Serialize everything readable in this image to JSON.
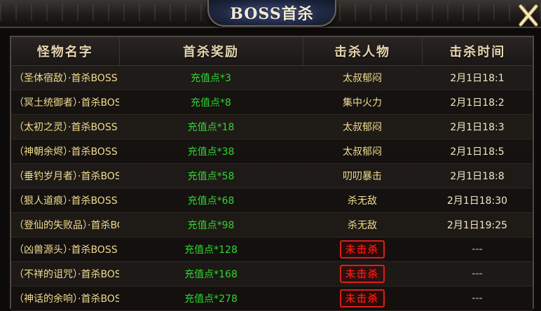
{
  "header": {
    "title": "BOSS首杀"
  },
  "columns": [
    "怪物名字",
    "首杀奖励",
    "击杀人物",
    "击杀时间"
  ],
  "rows": [
    {
      "name": "（圣体宿敌）·首杀BOSS",
      "reward": "充值点*3",
      "killer": "太叔郁闷",
      "time": "2月1日18:1",
      "killed": true
    },
    {
      "name": "（冥土统御者）·首杀BOSS",
      "reward": "充值点*8",
      "killer": "集中火力",
      "time": "2月1日18:2",
      "killed": true
    },
    {
      "name": "（太初之灵）·首杀BOSS",
      "reward": "充值点*18",
      "killer": "太叔郁闷",
      "time": "2月1日18:3",
      "killed": true
    },
    {
      "name": "（神朝余烬）·首杀BOSS",
      "reward": "充值点*38",
      "killer": "太叔郁闷",
      "time": "2月1日18:5",
      "killed": true
    },
    {
      "name": "（垂钓岁月者）·首杀BOSS",
      "reward": "充值点*58",
      "killer": "叨叨暴击",
      "time": "2月1日18:8",
      "killed": true
    },
    {
      "name": "（狠人道痕）·首杀BOSS",
      "reward": "充值点*68",
      "killer": "杀无敌",
      "time": "2月1日18:30",
      "killed": true
    },
    {
      "name": "（登仙的失败品）·首杀BOSS",
      "reward": "充值点*98",
      "killer": "杀无敌",
      "time": "2月1日19:25",
      "killed": true
    },
    {
      "name": "（凶兽源头）·首杀BOSS",
      "reward": "充值点*128",
      "killer": "未击杀",
      "time": "---",
      "killed": false
    },
    {
      "name": "（不祥的诅咒）·首杀BOSS",
      "reward": "充值点*168",
      "killer": "未击杀",
      "time": "---",
      "killed": false
    },
    {
      "name": "（神话的余响）·首杀BOSS",
      "reward": "充值点*278",
      "killer": "未击杀",
      "time": "---",
      "killed": false
    }
  ],
  "icons": {
    "close": "close-x-icon"
  },
  "colors": {
    "reward": "#2fd72f",
    "name": "#f1dc8f",
    "stamp": "#e21a12"
  }
}
